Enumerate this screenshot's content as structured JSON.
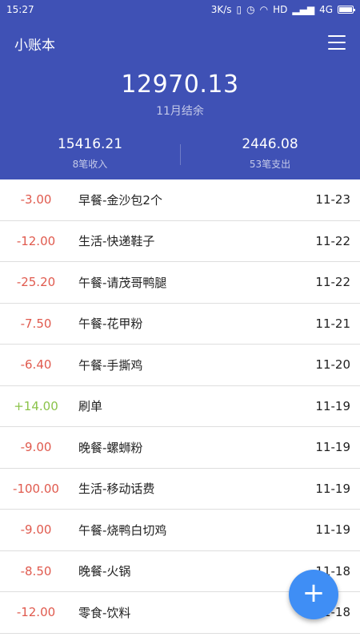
{
  "status_bar": {
    "time": "15:27",
    "net_speed": "3K/s",
    "network": "HD",
    "signal_label": "4G",
    "icons": [
      "vibrate-icon",
      "alarm-icon",
      "wifi-icon",
      "signal-icon",
      "battery-icon"
    ]
  },
  "header": {
    "title": "小账本",
    "balance": "12970.13",
    "balance_label": "11月结余",
    "income": "15416.21",
    "income_label": "8笔收入",
    "expense": "2446.08",
    "expense_label": "53笔支出"
  },
  "colors": {
    "primary": "#3f51b5",
    "expense_amount": "#e05a4e",
    "income_amount": "#8bc34a",
    "fab": "#3f8ef5"
  },
  "transactions": [
    {
      "amount": "-3.00",
      "desc": "早餐-金沙包2个",
      "date": "11-23"
    },
    {
      "amount": "-12.00",
      "desc": "生活-快递鞋子",
      "date": "11-22"
    },
    {
      "amount": "-25.20",
      "desc": "午餐-请茂哥鸭腿",
      "date": "11-22"
    },
    {
      "amount": "-7.50",
      "desc": "午餐-花甲粉",
      "date": "11-21"
    },
    {
      "amount": "-6.40",
      "desc": "午餐-手撕鸡",
      "date": "11-20"
    },
    {
      "amount": "+14.00",
      "desc": "刷单",
      "date": "11-19"
    },
    {
      "amount": "-9.00",
      "desc": "晚餐-螺蛳粉",
      "date": "11-19"
    },
    {
      "amount": "-100.00",
      "desc": "生活-移动话费",
      "date": "11-19"
    },
    {
      "amount": "-9.00",
      "desc": "午餐-烧鸭白切鸡",
      "date": "11-19"
    },
    {
      "amount": "-8.50",
      "desc": "晚餐-火锅",
      "date": "11-18"
    },
    {
      "amount": "-12.00",
      "desc": "零食-饮料",
      "date": "11-18"
    }
  ],
  "fab": {
    "label": "+"
  }
}
